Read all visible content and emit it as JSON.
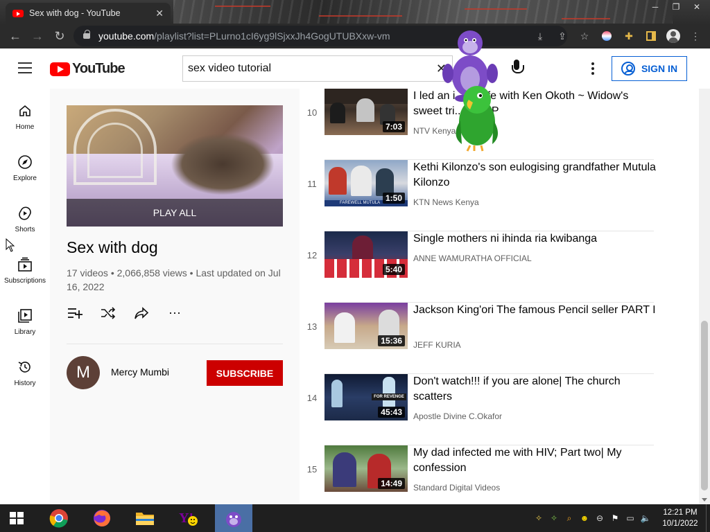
{
  "browser": {
    "tab_title": "Sex with dog - YouTube",
    "url_host": "youtube.com",
    "url_path": "/playlist?list=PLurno1cI6yg9lSjxxJh4GogUTUBXxw-vm"
  },
  "header": {
    "logo_text": "YouTube",
    "search_value": "sex video tutorial",
    "signin_label": "SIGN IN"
  },
  "leftnav": [
    {
      "label": "Home",
      "icon": "home-icon"
    },
    {
      "label": "Explore",
      "icon": "compass-icon"
    },
    {
      "label": "Shorts",
      "icon": "shorts-icon"
    },
    {
      "label": "Subscriptions",
      "icon": "subscriptions-icon"
    },
    {
      "label": "Library",
      "icon": "library-icon"
    },
    {
      "label": "History",
      "icon": "history-icon"
    }
  ],
  "playlist": {
    "play_all": "PLAY ALL",
    "title": "Sex with dog",
    "meta": "17 videos • 2,066,858 views • Last updated on Jul 16, 2022",
    "owner_initial": "M",
    "owner_name": "Mercy Mumbi",
    "subscribe_label": "SUBSCRIBE"
  },
  "videos": [
    {
      "index": "10",
      "title": "I led an i...ble life with Ken Okoth ~ Widow's sweet tri...ate MP",
      "channel": "NTV Kenya",
      "duration": "7:03"
    },
    {
      "index": "11",
      "title": "Kethi Kilonzo's son eulogising grandfather Mutula Kilonzo",
      "channel": "KTN News Kenya",
      "duration": "1:50"
    },
    {
      "index": "12",
      "title": "Single mothers ni ihinda ria kwibanga",
      "channel": "ANNE WAMURATHA OFFICIAL",
      "duration": "5:40"
    },
    {
      "index": "13",
      "title": "Jackson King'ori The famous Pencil seller PART I",
      "channel": "JEFF KURIA",
      "duration": "15:36"
    },
    {
      "index": "14",
      "title": "Don't watch!!! if you are alone| The church scatters",
      "channel": "Apostle Divine C.Okafor",
      "duration": "45:43"
    },
    {
      "index": "15",
      "title": "My dad infected me with HIV; Part two| My confession",
      "channel": "Standard Digital Videos",
      "duration": "14:49"
    }
  ],
  "thumb_text": {
    "farewell": "FAREWELL MUTULA",
    "revenge": "FOR REVENGE"
  },
  "taskbar": {
    "time": "12:21 PM",
    "date": "10/1/2022"
  }
}
